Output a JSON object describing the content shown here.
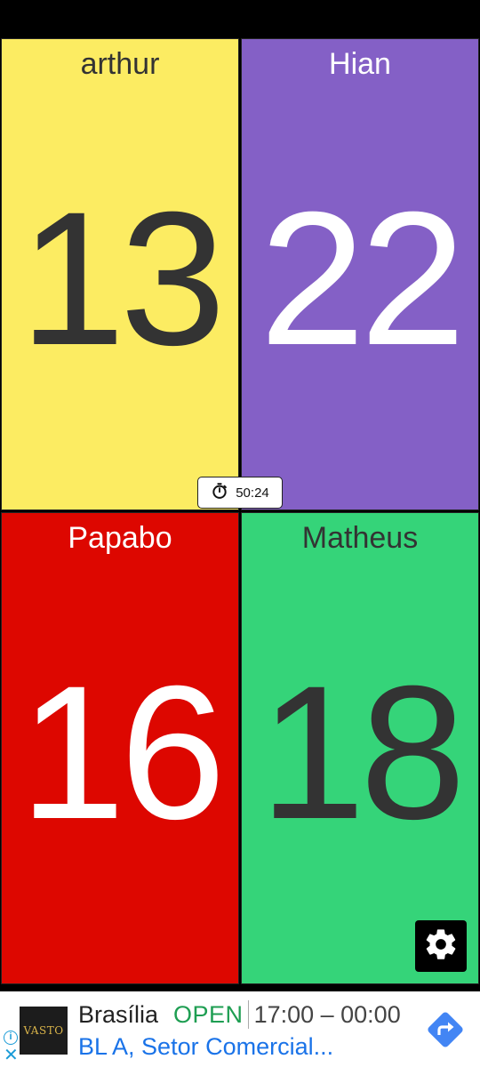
{
  "players": [
    {
      "name": "arthur",
      "score": "13",
      "bg": "#fcec62",
      "fg": "#333333"
    },
    {
      "name": "Hian",
      "score": "22",
      "bg": "#8460c6",
      "fg": "#ffffff"
    },
    {
      "name": "Papabo",
      "score": "16",
      "bg": "#dd0700",
      "fg": "#ffffff"
    },
    {
      "name": "Matheus",
      "score": "18",
      "bg": "#35d479",
      "fg": "#333333"
    }
  ],
  "timer": {
    "value": "50:24",
    "icon": "stopwatch-icon"
  },
  "settings": {
    "icon": "gear-icon"
  },
  "ad": {
    "logo_text": "VASTO",
    "title": "Brasília",
    "status": "OPEN",
    "hours": "17:00 – 00:00",
    "address": "BL A, Setor Comercial...",
    "status_color": "#1e9e52",
    "link_color": "#1a73e8"
  }
}
